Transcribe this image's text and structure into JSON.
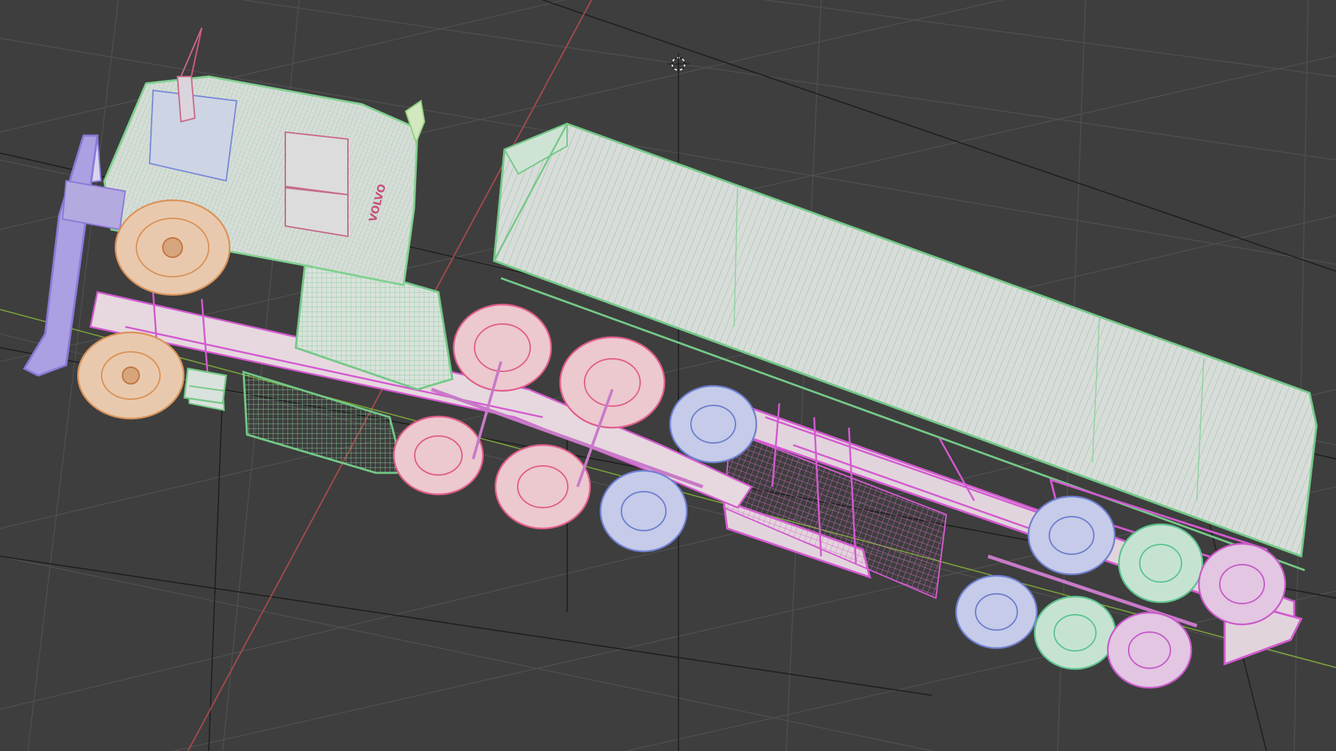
{
  "viewport": {
    "background": "#3e3e3e",
    "grid_color": "#4f4f4f",
    "axis_x_color": "#a34a4a",
    "axis_y_color": "#7da63a"
  },
  "model": {
    "cab_brand_text": "VOLVO",
    "wire_colors": {
      "cab_container": "#7fd08e",
      "chassis_trailer": "#d35ad0",
      "tire_front": "#d9935a",
      "tire_pink": "#e05e8a",
      "tire_blue": "#6f7fd0",
      "tire_green": "#5fc48f",
      "tire_magenta": "#c85ac8",
      "bumper": "#8c78d8"
    }
  }
}
